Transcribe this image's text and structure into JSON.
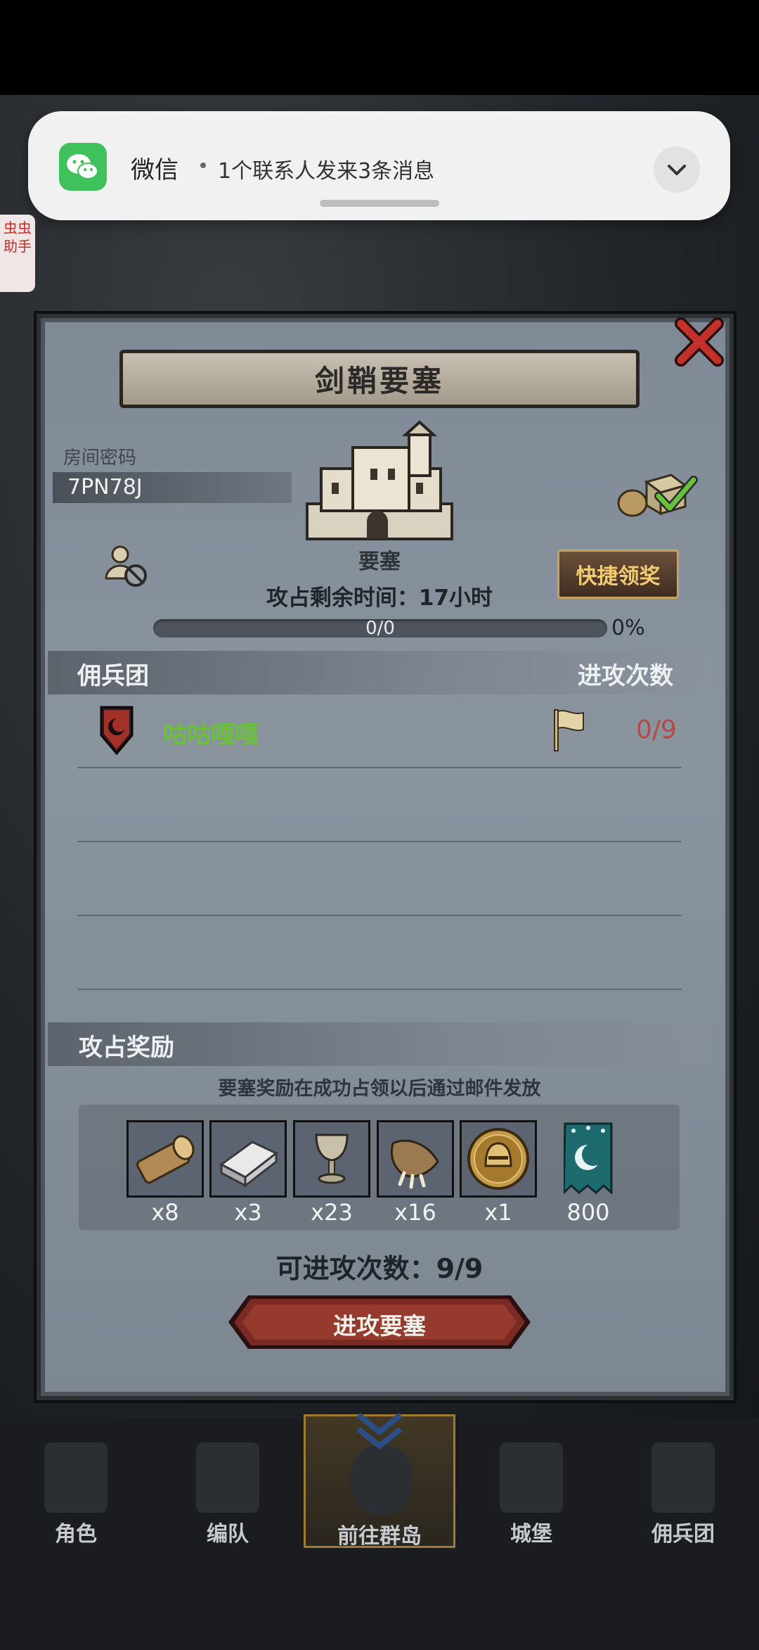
{
  "notification": {
    "app": "微信",
    "message": "1个联系人发来3条消息"
  },
  "helper_tab": "虫虫助手",
  "dialog": {
    "title": "剑鞘要塞",
    "room_label": "房间密码",
    "room_code": "7PN78J",
    "fortress_label": "要塞",
    "quick_claim": "快捷领奖",
    "time_text": "攻占剩余时间：17小时",
    "progress_text": "0/0",
    "progress_fraction": 0,
    "progress_pct": "0%",
    "guild_header": "佣兵团",
    "attacks_header": "进攻次数",
    "guild_row": {
      "name": "咕咕嘎嘎",
      "count": "0/9"
    },
    "rewards_header": "攻占奖励",
    "rewards_note": "要塞奖励在成功占领以后通过邮件发放",
    "rewards": [
      {
        "icon": "log-icon",
        "qty": "x8"
      },
      {
        "icon": "iron-ingot-icon",
        "qty": "x3"
      },
      {
        "icon": "goblet-icon",
        "qty": "x23"
      },
      {
        "icon": "claw-icon",
        "qty": "x16"
      },
      {
        "icon": "helmet-coin-icon",
        "qty": "x1"
      },
      {
        "icon": "banner-icon",
        "qty": "800"
      }
    ],
    "attack_count": "可进攻次数：9/9",
    "attack_button": "进攻要塞"
  },
  "nav": [
    {
      "label": "角色"
    },
    {
      "label": "编队"
    },
    {
      "label": "前往群岛"
    },
    {
      "label": "城堡"
    },
    {
      "label": "佣兵团"
    }
  ],
  "colors": {
    "guild_name": "#6bbf3d",
    "attack_count_red": "#b54a44",
    "quick_btn_text": "#f3cc72",
    "wechat_green": "#3fc15c"
  }
}
